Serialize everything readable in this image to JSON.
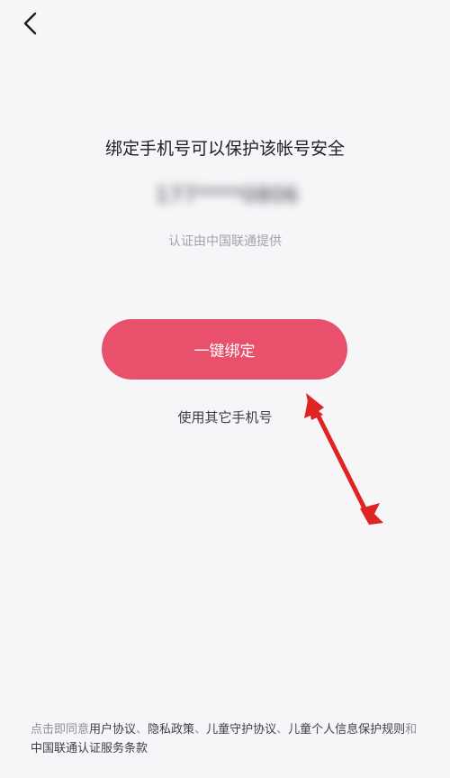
{
  "nav": {
    "back_icon": "chevron-left-icon"
  },
  "main": {
    "title": "绑定手机号可以保护该帐号安全",
    "phone_masked": "177****0806",
    "provider_note": "认证由中国联通提供",
    "bind_button_label": "一键绑定",
    "other_phone_label": "使用其它手机号"
  },
  "annotation": {
    "arrow_icon": "red-arrow-icon",
    "arrow_color": "#e02424"
  },
  "agreement": {
    "prefix": "点击即同意",
    "user_agreement": "用户协议",
    "sep1": "、",
    "privacy_policy": "隐私政策",
    "sep2": "、",
    "child_protection": "儿童守护协议",
    "sep3": "、",
    "child_info_rules": "儿童个人信息保护规则",
    "and": "和",
    "unicom_terms": "中国联通认证服务条款"
  },
  "colors": {
    "accent": "#e8506b",
    "background": "#f6f6f8"
  }
}
